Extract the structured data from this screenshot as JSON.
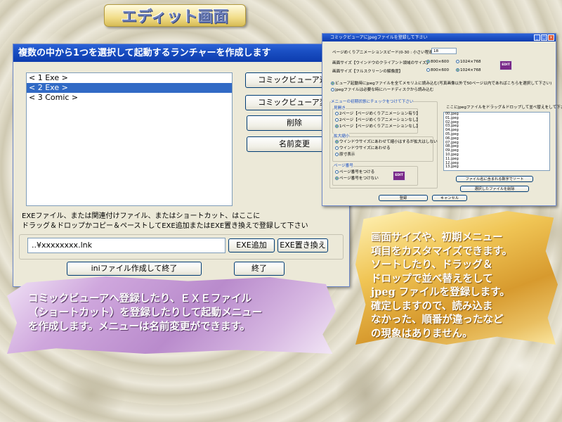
{
  "banner": {
    "title": "エディット画面"
  },
  "launcher": {
    "title": "複数の中から1つを選択して起動するランチャーを作成します",
    "list_items": [
      "< 1 Exe >",
      "< 2 Exe >",
      "< 3 Comic >"
    ],
    "selected_index": 1,
    "buttons": {
      "comic_add": "コミックビューア追加",
      "comic_change": "コミックビューア変更",
      "delete": "削除",
      "rename": "名前変更"
    },
    "note_line1": "EXEファイル、または関連付けファイル、またはショートカット、はここに",
    "note_line2": "ドラッグ＆ドロップかコピー＆ペーストしてEXE追加またはEXE置き換えで登録して下さい",
    "path_value": "..¥xxxxxxxx.lnk",
    "exe_add": "EXE追加",
    "exe_replace": "EXE置き換え",
    "ini_finish": "iniファイル作成して終了",
    "finish": "終了"
  },
  "viewer": {
    "title": "コミックビューアにjpegファイルを登録して下さい",
    "anim_speed_label": "ページめくりアニメーションスピード(0-30 : 小さい程速い)",
    "anim_speed_value": "18",
    "screen_size_window_label": "画面サイズ【ウインドウのクライアント領域のサイズ】",
    "screen_size_full_label": "画面サイズ【フルスクリーンの解像度】",
    "size_800": "800×600",
    "size_1024": "1024×768",
    "edit_badge": "EDIT",
    "radio_copy": "ビューア起動時にjpegファイルを全てメモリ上に読み込む(写真画像以外で50ページ以内であればこちらを選択して下さい)",
    "radio_disk": "jpegファイルは必要な時にハードディスクから読み込む",
    "menu_group": "メニューの初期状態にチェックをつけて下さい",
    "open_group": "見開き",
    "open_opts": [
      "2ページ【ページめくりアニメーション有り】",
      "2ページ【ページめくりアニメーションなし】",
      "1ページ【ページめくりアニメーションなし】"
    ],
    "zoom_group": "拡大縮小",
    "zoom_opts": [
      "ウインドウサイズにあわせて縮小はするが拡大はしない",
      "ウインドウサイズにあわせる",
      "原寸表示"
    ],
    "page_group": "ページ番号",
    "page_opts": [
      "ページ番号をつける",
      "ページ番号をつけない"
    ],
    "drop_label": "ここにjpegファイルをドラッグ＆ドロップして並べ替えをして下さい",
    "files": [
      "00.jpeg",
      "01.jpeg",
      "02.jpeg",
      "03.jpeg",
      "04.jpeg",
      "05.jpeg",
      "06.jpeg",
      "07.jpeg",
      "08.jpeg",
      "09.jpeg",
      "10.jpeg",
      "11.jpeg",
      "12.jpeg",
      "13.jpeg"
    ],
    "sort_button": "ファイル名に含まれる数字でソート",
    "delete_button": "選択したファイルを削除",
    "ok_button": "登録",
    "cancel_button": "キャンセル"
  },
  "caption_left": {
    "line1": "コミックビューアへ登録したり、ＥＸＥファイル",
    "line2": "（ショートカット）を登録したりして起動メニュー",
    "line3": "を作成します。メニューは名前変更ができます。"
  },
  "caption_right": {
    "lines": [
      "画面サイズや、初期メニュー",
      "項目をカスタマイズできます。",
      "ソートしたり、ドラッグ＆",
      "ドロップで並べ替えをして",
      "jpeg ファイルを登録します。",
      "確定しますので、読み込ま",
      "なかった、順番が違ったなど",
      "の現象はありません。"
    ]
  }
}
